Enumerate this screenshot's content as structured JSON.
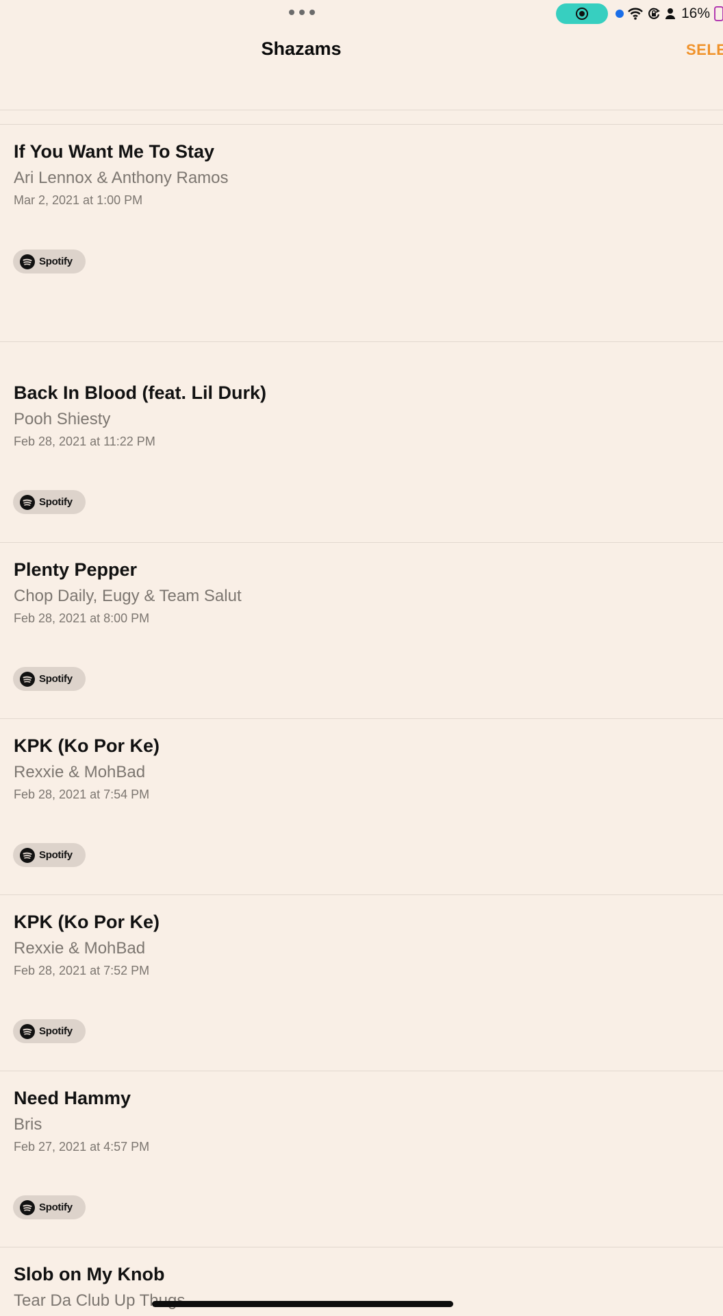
{
  "status_bar": {
    "battery_percent": "16%",
    "record_color": "#37cfc0",
    "location_dot_color": "#1a6ee8",
    "icons": [
      "more-dots-icon",
      "screen-record-icon",
      "location-dot-icon",
      "wifi-icon",
      "orientation-lock-icon",
      "person-icon",
      "battery-icon"
    ]
  },
  "nav": {
    "title": "Shazams",
    "select_label": "SELE",
    "accent_color": "#f0922a"
  },
  "items": [
    {
      "title": "If You Want Me To Stay",
      "artist": "Ari Lennox & Anthony Ramos",
      "date": "Mar 2, 2021 at 1:00 PM",
      "button": "Spotify"
    },
    {
      "title": "Back In Blood (feat. Lil Durk)",
      "artist": "Pooh Shiesty",
      "date": "Feb 28, 2021 at 11:22 PM",
      "button": "Spotify"
    },
    {
      "title": "Plenty Pepper",
      "artist": "Chop Daily, Eugy & Team Salut",
      "date": "Feb 28, 2021 at 8:00 PM",
      "button": "Spotify"
    },
    {
      "title": "KPK (Ko Por Ke)",
      "artist": "Rexxie & MohBad",
      "date": "Feb 28, 2021 at 7:54 PM",
      "button": "Spotify"
    },
    {
      "title": "KPK (Ko Por Ke)",
      "artist": "Rexxie & MohBad",
      "date": "Feb 28, 2021 at 7:52 PM",
      "button": "Spotify"
    },
    {
      "title": "Need Hammy",
      "artist": "Bris",
      "date": "Feb 27, 2021 at 4:57 PM",
      "button": "Spotify"
    },
    {
      "title": "Slob on My Knob",
      "artist": "Tear Da Club Up Thugs"
    }
  ]
}
